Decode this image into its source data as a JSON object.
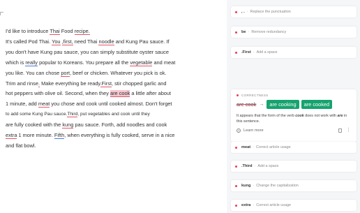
{
  "editor": {
    "lines": [
      [
        {
          "t": "I'd like to introduce "
        },
        {
          "t": "Thai",
          "u": "red"
        },
        {
          "t": " Food "
        },
        {
          "t": "recipe.",
          "u": "red"
        }
      ],
      [
        {
          "t": "It's called Pod Thai. "
        },
        {
          "t": "You",
          "u": "red"
        },
        {
          "t": " "
        },
        {
          "t": ",first,",
          "u": "red"
        },
        {
          "t": " need Thai "
        },
        {
          "t": "noodle",
          "u": "red"
        },
        {
          "t": " and Kung Pau sauce. If"
        }
      ],
      [
        {
          "t": "you don't have Kung pau sauce, you can simply substitute oyster sauce"
        }
      ],
      [
        {
          "t": "which is "
        },
        {
          "t": "really",
          "u": "blue"
        },
        {
          "t": " popular to Koreans. You prepare all the "
        },
        {
          "t": "vegetable",
          "u": "red"
        },
        {
          "t": " and meat"
        }
      ],
      [
        {
          "t": "you like. You can chose "
        },
        {
          "t": "port",
          "u": "red"
        },
        {
          "t": ", beef or chicken. Whatever you pick is ok."
        }
      ],
      [
        {
          "t": "Trim and rinse"
        },
        {
          "t": ".",
          "u": "red"
        },
        {
          "t": " Make everything be ready"
        },
        {
          "t": ".First",
          "u": "red"
        },
        {
          "t": ", stir chopped garlic and"
        }
      ],
      [
        {
          "t": "hot peppers with olive oil. Second, when they "
        },
        {
          "t": "are cook",
          "u": "hl"
        },
        {
          "t": " a little after about"
        }
      ],
      [
        {
          "t": "1 minute, add "
        },
        {
          "t": "meat",
          "u": "red"
        },
        {
          "t": " you chose and cook until cooked almost. Don't forget"
        }
      ],
      [
        {
          "t": "to add some Kung Pau sauce."
        },
        {
          "t": "Third",
          "u": "red"
        },
        {
          "t": ", put vegetables and cook until they"
        }
      ],
      [
        {
          "t": "are fully cooked with the "
        },
        {
          "t": "kung",
          "u": "red"
        },
        {
          "t": " pau sauce. Forth, add noodles and cook"
        }
      ],
      [
        {
          "t": "extra",
          "u": "red"
        },
        {
          "t": " 1 more minute. "
        },
        {
          "t": "Fifth",
          "u": "blue"
        },
        {
          "t": ", when everything is fully cooked, serve in a nice"
        }
      ],
      [
        {
          "t": "and flat bowl."
        }
      ]
    ]
  },
  "suggestions_top": [
    {
      "word": ", .",
      "desc": "Replace the punctuation"
    },
    {
      "word": "be",
      "desc": "Remove redundancy"
    },
    {
      "word": ".First",
      "desc": "Add a space"
    }
  ],
  "expanded": {
    "category": "CORRECTNESS",
    "original": "are cook",
    "options": [
      "are cooking",
      "are cooked"
    ],
    "note_pre": "It appears that the form of the verb ",
    "note_verb": "cook",
    "note_mid": " does not work with ",
    "note_subj": "are",
    "note_post": " in this sentence.",
    "learn_more": "Learn more"
  },
  "suggestions_bottom": [
    {
      "word": "meat",
      "desc": "Correct article usage"
    },
    {
      "word": ".Third",
      "desc": "Add a space"
    },
    {
      "word": "kung",
      "desc": "Change the capitalization"
    },
    {
      "word": "extra",
      "desc": "Correct article usage"
    }
  ],
  "colors": {
    "accent_red": "#e0405a",
    "accept_green": "#16a36f",
    "highlight": "#f6c6cf"
  }
}
